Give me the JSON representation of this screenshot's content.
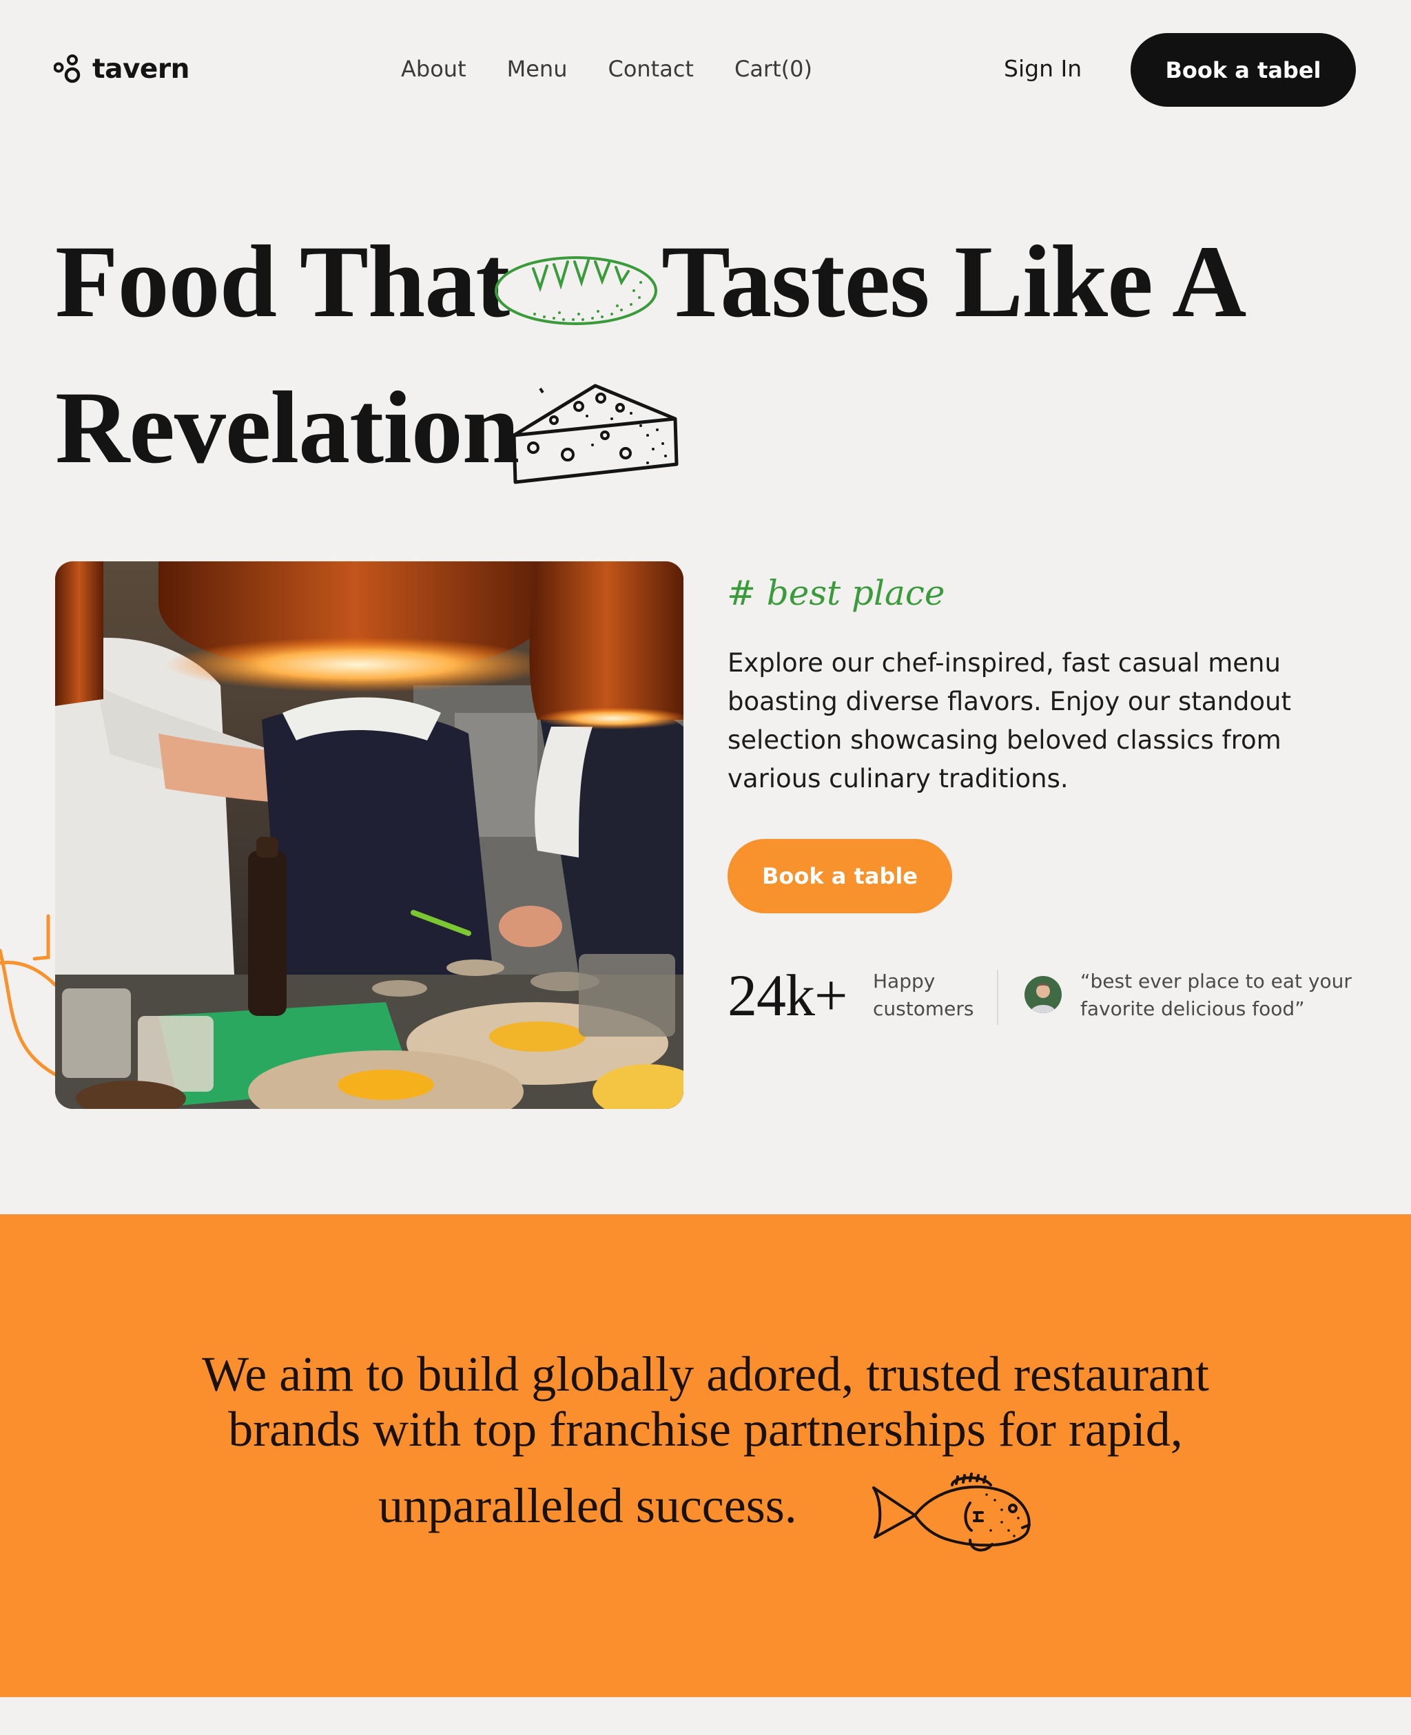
{
  "brand": {
    "name": "tavern"
  },
  "nav": {
    "links": [
      "About",
      "Menu",
      "Contact",
      "Cart(0)"
    ],
    "sign_in": "Sign In",
    "cta": "Book a tabel"
  },
  "hero": {
    "line1_part1": "Food That",
    "line1_part2": "Tastes Like A",
    "line2": "Revelation"
  },
  "intro": {
    "tag": "# best place",
    "description": "Explore our chef-inspired, fast casual menu boasting diverse flavors. Enjoy our standout selection showcasing beloved classics from various culinary traditions.",
    "cta": "Book a table",
    "stat_value": "24k+",
    "stat_label": "Happy customers",
    "testimonial": "“best ever place to eat your favorite delicious food”"
  },
  "mission": {
    "line1": "We aim to build globally adored, trusted restaurant",
    "line2": "brands with top franchise partnerships for rapid,",
    "line3": "unparalleled success."
  },
  "colors": {
    "background": "#f2f1f0",
    "accent_orange": "#fb8f2d",
    "button_orange": "#f7922c",
    "accent_green": "#3a9b3a",
    "dark": "#111111"
  },
  "icons": [
    "tavern-logo-icon",
    "bread-icon",
    "cheese-icon",
    "fish-icon",
    "squiggle-decoration"
  ]
}
